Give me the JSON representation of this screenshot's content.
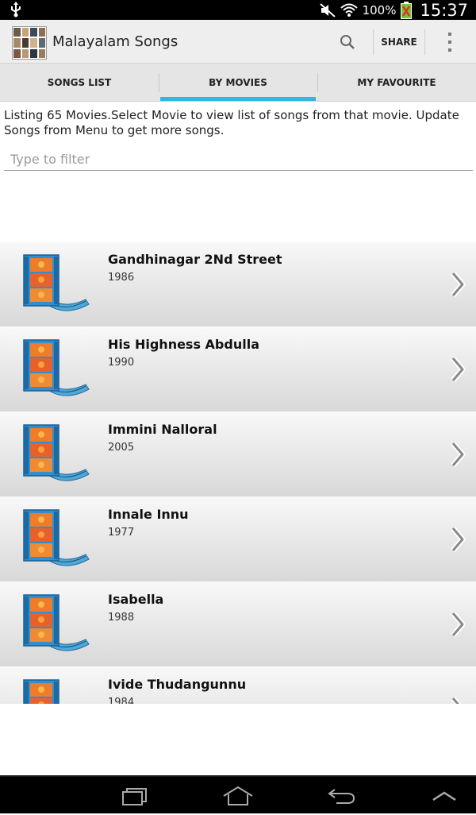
{
  "status_bar": {
    "battery": "100%",
    "time": "15:37"
  },
  "app": {
    "title": "Malayalam Songs",
    "share_label": "SHARE"
  },
  "tabs": [
    {
      "label": "SONGS LIST"
    },
    {
      "label": "BY MOVIES"
    },
    {
      "label": "MY FAVOURITE"
    }
  ],
  "info": "Listing 65 Movies.Select Movie to view list of songs from that movie. Update Songs from Menu to get more songs.",
  "filter": {
    "placeholder": "Type to filter",
    "value": ""
  },
  "movies": [
    {
      "name": "Gandhinagar 2Nd Street",
      "year": "1986"
    },
    {
      "name": "His Highness Abdulla",
      "year": "1990"
    },
    {
      "name": "Immini Nalloral",
      "year": "2005"
    },
    {
      "name": "Innale Innu",
      "year": "1977"
    },
    {
      "name": "Isabella",
      "year": "1988"
    },
    {
      "name": "Ivide Thudangunnu",
      "year": "1984"
    }
  ],
  "colors": {
    "accent": "#33b5e5",
    "action_bar": "#eeeeee",
    "tab_bar": "#e5e5e5"
  },
  "icons": {
    "usb": "usb-icon",
    "mute": "mute-icon",
    "wifi": "wifi-icon",
    "battery": "battery-icon",
    "search": "search-icon",
    "overflow": "overflow-menu-icon",
    "movie": "film-reel-icon",
    "chevron": "chevron-right-icon"
  }
}
